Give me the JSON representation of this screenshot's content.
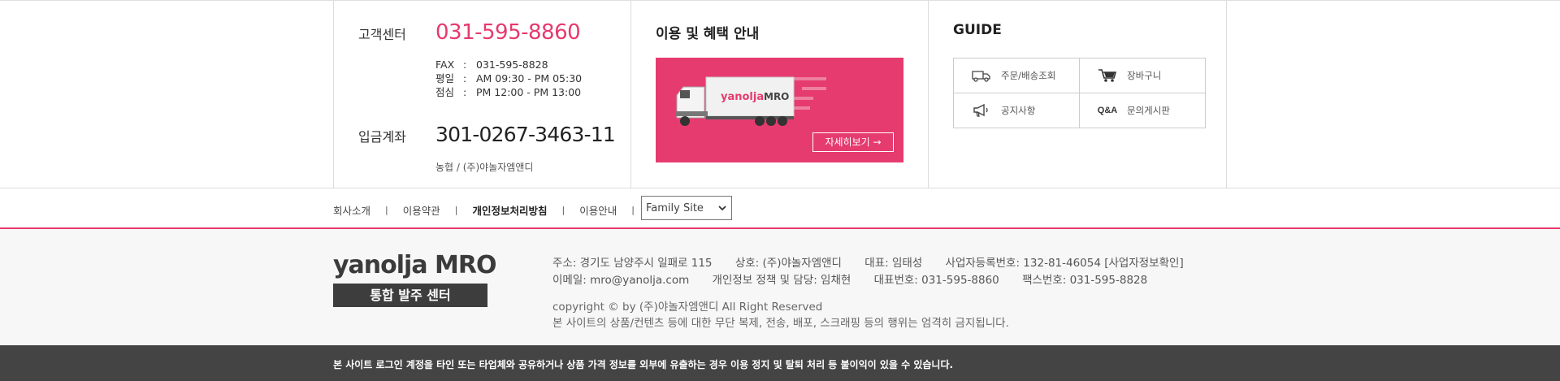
{
  "customer_center": {
    "label": "고객센터",
    "phone": "031-595-8860",
    "details": [
      {
        "key": "FAX",
        "colon": ":",
        "value": "031-595-8828"
      },
      {
        "key": "평일",
        "colon": ":",
        "value": "AM 09:30 - PM 05:30"
      },
      {
        "key": "점심",
        "colon": ":",
        "value": "PM 12:00 - PM 13:00"
      }
    ]
  },
  "deposit": {
    "label": "입금계좌",
    "account": "301-0267-3463-11",
    "bank": "농협 / (주)야놀자엠앤디"
  },
  "benefits": {
    "title": "이용 및 혜택 안내",
    "truck_brand": "yanolja",
    "truck_suffix": "MRO",
    "button": "자세히보기 →",
    "accent": "#e63b6f"
  },
  "guide": {
    "title": "GUIDE",
    "items": [
      {
        "icon": "truck-icon",
        "label": "주문/배송조회"
      },
      {
        "icon": "cart-icon",
        "label": "장바구니"
      },
      {
        "icon": "megaphone-icon",
        "label": "공지사항"
      },
      {
        "icon": "qa-icon",
        "icon_text": "Q&A",
        "label": "문의게시판"
      }
    ]
  },
  "nav": {
    "items": [
      "회사소개",
      "이용약관",
      "개인정보처리방침",
      "이용안내"
    ],
    "separator": "|",
    "family_site": "Family Site"
  },
  "footer": {
    "logo": "yanolja MRO",
    "logo_sub": "통합 발주 센터",
    "row1": [
      "주소: 경기도 남양주시 일패로 115",
      "상호: (주)야놀자엠앤디",
      "대표: 임태성",
      "사업자등록번호: 132-81-46054 [사업자정보확인]"
    ],
    "row2": [
      "이메일: mro@yanolja.com",
      "개인정보 정책 및 담당: 임채현",
      "대표번호: 031-595-8860",
      "팩스번호: 031-595-8828"
    ],
    "copyright": "copyright © by (주)야놀자엠앤디 All Right Reserved",
    "notice": "본 사이트의 상품/컨텐츠 등에 대한 무단 복제, 전송, 배포, 스크래핑 등의 행위는 엄격히 금지됩니다."
  },
  "bottom_bar": {
    "text": "본 사이트 로그인 계정을 타인 또는 타업체와 공유하거나 상품 가격 정보를 외부에 유출하는 경우 이용 정지 및 탈퇴 처리 등 불이익이 있을 수 있습니다."
  }
}
